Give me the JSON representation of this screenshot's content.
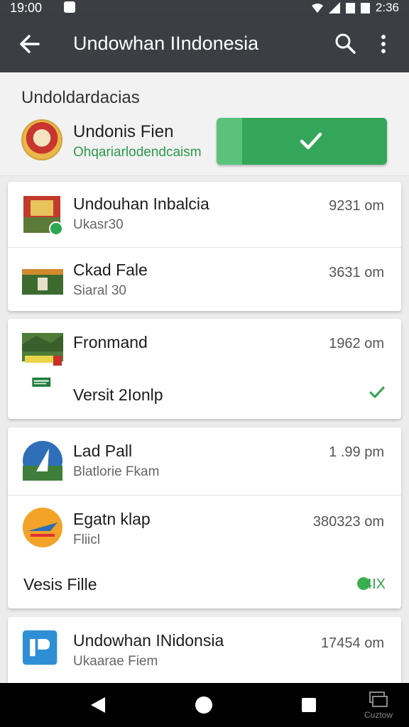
{
  "status_bar": {
    "time": "19:00",
    "battery": "2:36"
  },
  "app_bar": {
    "title": "Undowhan IIndonesia"
  },
  "header": {
    "section_title": "Undoldardacias",
    "name": "Undonis Fien",
    "subtitle": "Ohqariarlodendcaism"
  },
  "cards": [
    {
      "rows": [
        {
          "name": "Undouhan Inbalcia",
          "sub": "Ukasr30",
          "size": "9231 om"
        },
        {
          "name": "Ckad Fale",
          "sub": "Siaral 30",
          "size": "3631 om"
        }
      ]
    },
    {
      "rows": [
        {
          "name": "Fronmand",
          "sub": "",
          "size": "1962 om"
        },
        {
          "name": "Versit 2Ionlp",
          "sub": "",
          "size": ""
        }
      ]
    },
    {
      "rows": [
        {
          "name": "Lad Pall",
          "sub": "Blatlorie Fkam",
          "size": "1 .99 pm"
        },
        {
          "name": "Egatn klap",
          "sub": "Fliicl",
          "size": "380323 om"
        },
        {
          "name": "Vesis Fille",
          "sub": "",
          "size": "",
          "badge": "4IX"
        }
      ]
    },
    {
      "rows": [
        {
          "name": "Undowhan INidonsia",
          "sub": "Ukaarae Fiem",
          "size": "17454 om"
        }
      ]
    }
  ],
  "nav_bar": {
    "extra_label": "Cuztow"
  },
  "colors": {
    "appbar": "#3b3f44",
    "accent_green": "#33a65a",
    "background": "#ececec"
  }
}
